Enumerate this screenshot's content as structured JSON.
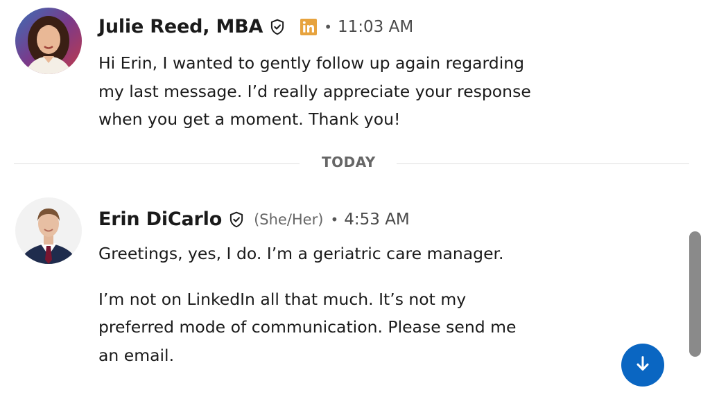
{
  "messages": [
    {
      "sender": "Julie Reed, MBA",
      "verified": true,
      "premium_badge": "linkedin-premium-icon",
      "pronouns": "",
      "separator": "•",
      "time": "11:03 AM",
      "paragraphs": [
        "Hi Erin, I wanted to gently follow up again regarding my last message. I’d really appreciate your response when you get a moment. Thank you!"
      ]
    },
    {
      "sender": "Erin DiCarlo",
      "verified": true,
      "pronouns": "(She/Her)",
      "separator": "•",
      "time": "4:53 AM",
      "paragraphs": [
        "Greetings, yes, I do. I’m a geriatric care manager.",
        "I’m not on LinkedIn all that much. It’s not my preferred mode of communication. Please send me an email."
      ]
    }
  ],
  "divider": {
    "label": "TODAY"
  },
  "colors": {
    "accent_blue": "#0a66c2",
    "premium_gold": "#e7a33e",
    "divider_line": "#e0e0e0",
    "scrollbar": "#8a8a8a"
  },
  "icons": {
    "verified": "shield-check-icon",
    "scroll_down": "arrow-down-icon"
  }
}
